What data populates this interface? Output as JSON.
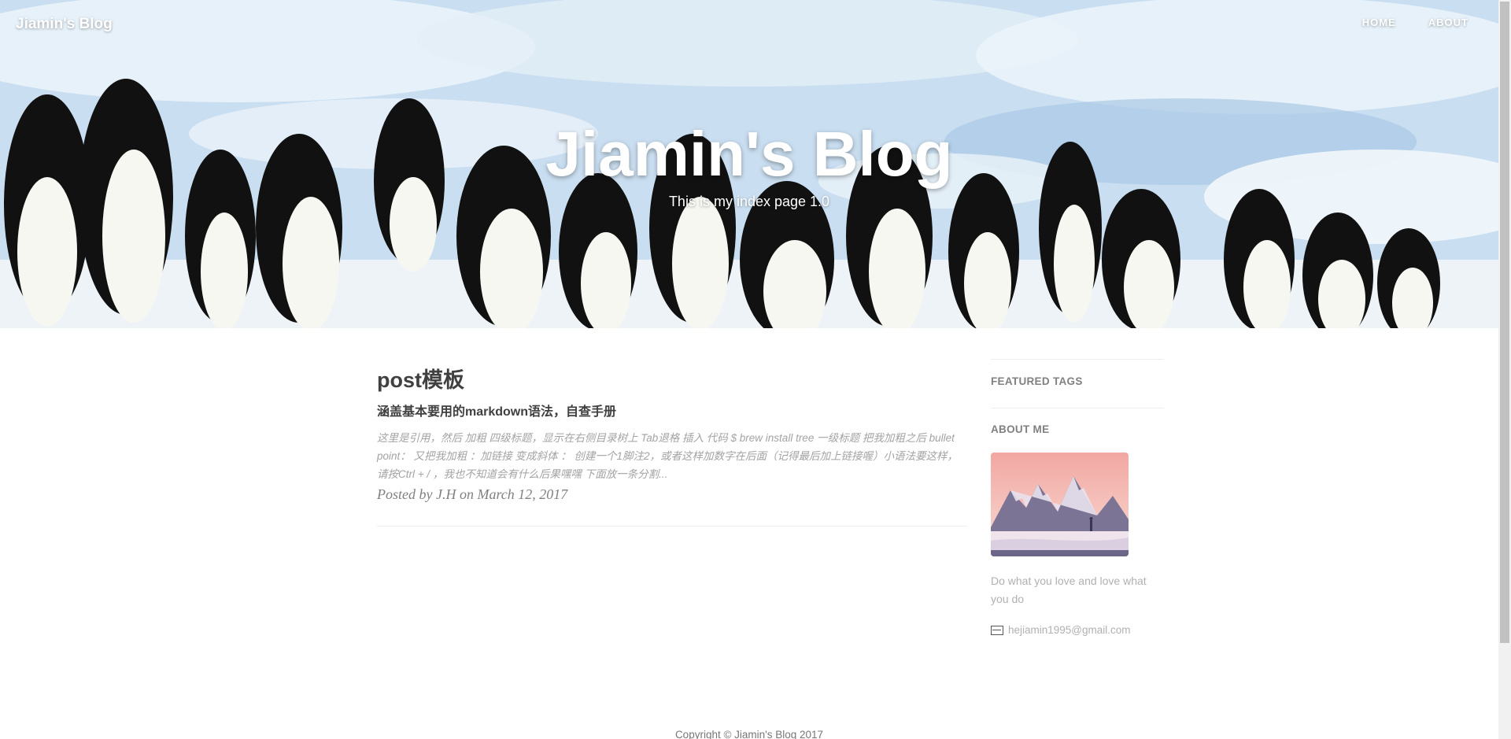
{
  "nav": {
    "brand": "Jiamin's Blog",
    "links": [
      "HOME",
      "ABOUT"
    ]
  },
  "hero": {
    "title": "Jiamin's Blog",
    "subtitle": "This is my index page 1.0"
  },
  "post": {
    "title": "post模板",
    "subtitle": "涵盖基本要用的markdown语法，自查手册",
    "excerpt": "这里是引用，然后 加粗 四级标题，显示在右侧目录树上 Tab退格 插入 代码 $ brew install tree 一级标题 把我加粗之后 bullet point： 又把我加粗 ：加链接 变成斜体 ： 创建一个1脚注2，或者这样加数字在后面（记得最后加上链接喔）小语法要这样，请按Ctrl + / ，我也不知道会有什么后果嘿嘿 下面放一条分割...",
    "meta": "Posted by J.H on March 12, 2017"
  },
  "sidebar": {
    "featured_tags_heading": "FEATURED TAGS",
    "about_heading": "ABOUT ME",
    "motto": "Do what you love and love what you do",
    "email": "hejiamin1995@gmail.com"
  },
  "footer": {
    "copyright": "Copyright © Jiamin's Blog 2017"
  },
  "colors": {
    "text": "#404040",
    "muted": "#a3a3a3",
    "divider": "#eeeeee"
  }
}
